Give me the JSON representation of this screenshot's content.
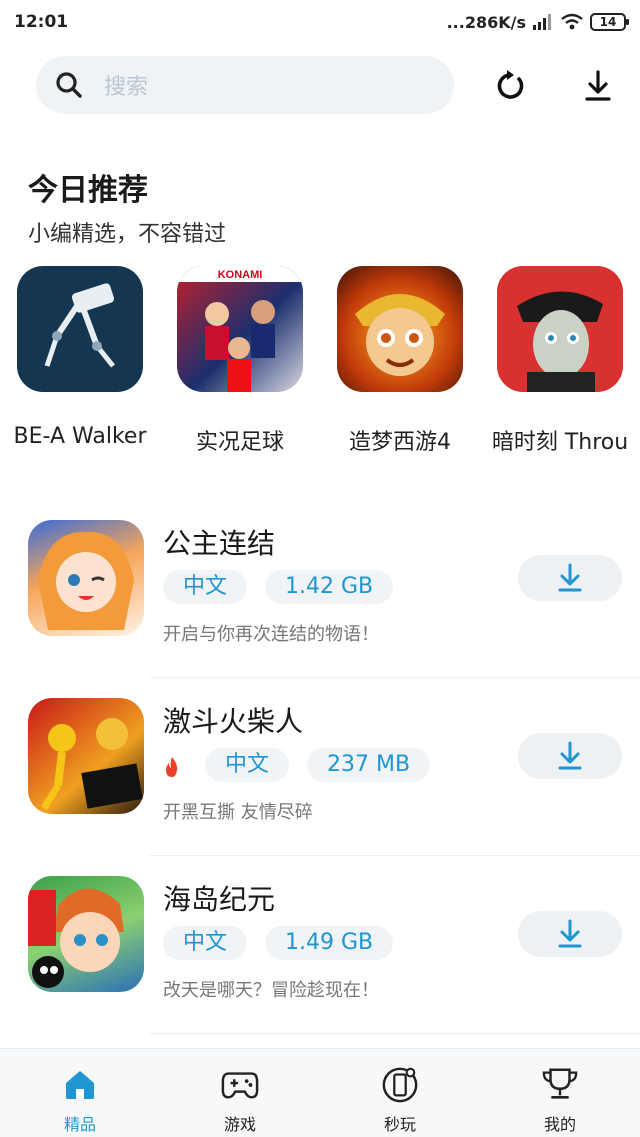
{
  "status": {
    "time": "12:01",
    "network_speed": "...286K/s",
    "battery": "14"
  },
  "search": {
    "placeholder": "搜索"
  },
  "recommend": {
    "title": "今日推荐",
    "subtitle": "小编精选，不容错过",
    "items": [
      {
        "label": "BE-A Walker",
        "icon": "be-a-walker-game-icon"
      },
      {
        "label": "实况足球",
        "icon": "pes-soccer-game-icon"
      },
      {
        "label": "造梦西游4",
        "icon": "monkey-king-game-icon"
      },
      {
        "label": "暗时刻 Throu",
        "icon": "dark-moment-game-icon"
      }
    ]
  },
  "apps": [
    {
      "name": "公主连结",
      "hot": false,
      "language": "中文",
      "size": "1.42 GB",
      "desc": "开启与你再次连结的物语！"
    },
    {
      "name": "激斗火柴人",
      "hot": true,
      "language": "中文",
      "size": "237 MB",
      "desc": "开黑互撕 友情尽碎"
    },
    {
      "name": "海岛纪元",
      "hot": false,
      "language": "中文",
      "size": "1.49 GB",
      "desc": "改天是哪天？冒险趁现在！"
    }
  ],
  "nav": {
    "items": [
      {
        "label": "精品",
        "icon": "home-icon",
        "active": true
      },
      {
        "label": "游戏",
        "icon": "gamepad-icon",
        "active": false
      },
      {
        "label": "秒玩",
        "icon": "instant-play-icon",
        "active": false
      },
      {
        "label": "我的",
        "icon": "trophy-icon",
        "active": false
      }
    ]
  },
  "colors": {
    "accent": "#1f95d1",
    "tag_bg": "#f1f4f6",
    "search_bg": "#f0f3f6"
  }
}
